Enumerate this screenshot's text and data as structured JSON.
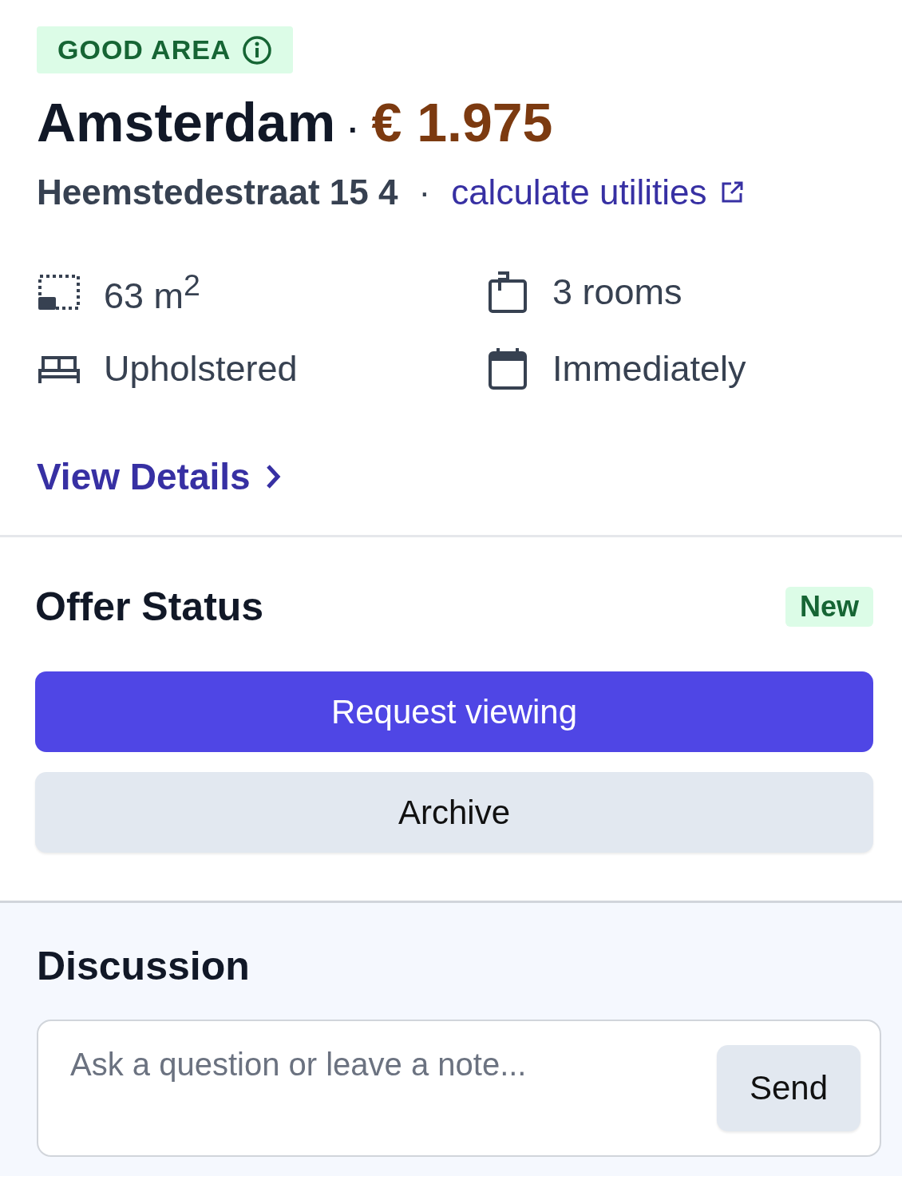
{
  "area_badge": {
    "label": "GOOD AREA"
  },
  "title": {
    "city": "Amsterdam",
    "separator": "·",
    "price": "€ 1.975"
  },
  "address": {
    "street": "Heemstedestraat 15 4",
    "separator": "·",
    "utilities_link": "calculate utilities"
  },
  "features": [
    {
      "kind": "area",
      "text": "63 m$^{2}$"
    },
    {
      "kind": "rooms",
      "text": "3 rooms"
    },
    {
      "kind": "furniture",
      "text": "Upholstered"
    },
    {
      "kind": "availability",
      "text": "Immediately"
    }
  ],
  "details_link": "View Details",
  "offer": {
    "title": "Offer Status",
    "status": "New",
    "buttons": [
      {
        "kind": "primary",
        "label": "Request viewing"
      },
      {
        "kind": "secondary",
        "label": "Archive"
      }
    ]
  },
  "discussion": {
    "title": "Discussion",
    "placeholder": "Ask a question or leave a note...",
    "send": "Send"
  }
}
